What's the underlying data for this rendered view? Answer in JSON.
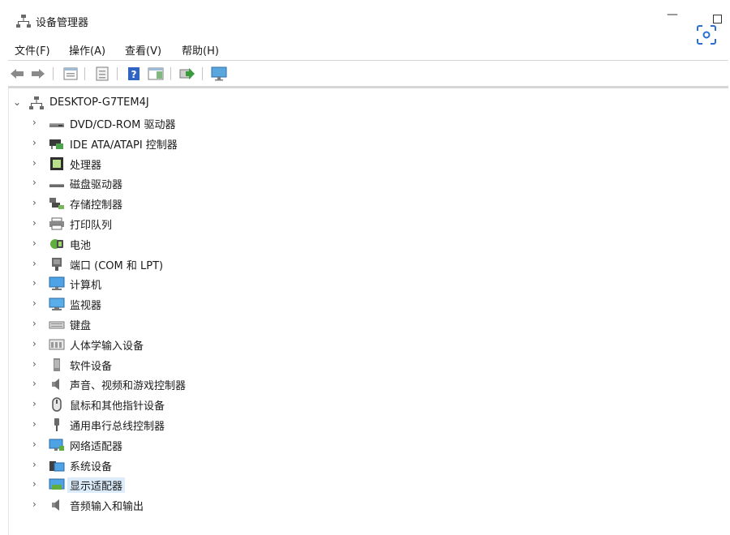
{
  "window": {
    "title": "设备管理器",
    "icons": {
      "app": "device-manager-icon",
      "minimize": "minimize-icon",
      "maximize": "maximize-icon",
      "overlay": "screenshot-lens-icon"
    }
  },
  "menu": [
    "文件(F)",
    "操作(A)",
    "查看(V)",
    "帮助(H)"
  ],
  "toolbar": [
    "back-arrow-icon",
    "forward-arrow-icon",
    "properties-icon",
    "show-hidden-icon",
    "help-icon",
    "action-pane-icon",
    "update-driver-icon",
    "scan-hardware-icon"
  ],
  "tree": {
    "root": {
      "label": "DESKTOP-G7TEM4J",
      "icon": "computer-network-icon",
      "expanded": true
    },
    "items": [
      {
        "label": "DVD/CD-ROM 驱动器",
        "icon": "dvd-drive-icon"
      },
      {
        "label": "IDE ATA/ATAPI 控制器",
        "icon": "ide-controller-icon"
      },
      {
        "label": "处理器",
        "icon": "processor-icon"
      },
      {
        "label": "磁盘驱动器",
        "icon": "disk-drive-icon"
      },
      {
        "label": "存储控制器",
        "icon": "storage-controller-icon"
      },
      {
        "label": "打印队列",
        "icon": "printer-icon"
      },
      {
        "label": "电池",
        "icon": "battery-icon"
      },
      {
        "label": "端口 (COM 和 LPT)",
        "icon": "port-icon"
      },
      {
        "label": "计算机",
        "icon": "computer-icon"
      },
      {
        "label": "监视器",
        "icon": "monitor-icon"
      },
      {
        "label": "键盘",
        "icon": "keyboard-icon"
      },
      {
        "label": "人体学输入设备",
        "icon": "hid-icon"
      },
      {
        "label": "软件设备",
        "icon": "software-device-icon"
      },
      {
        "label": "声音、视频和游戏控制器",
        "icon": "speaker-icon"
      },
      {
        "label": "鼠标和其他指针设备",
        "icon": "mouse-icon"
      },
      {
        "label": "通用串行总线控制器",
        "icon": "usb-icon"
      },
      {
        "label": "网络适配器",
        "icon": "network-adapter-icon"
      },
      {
        "label": "系统设备",
        "icon": "system-device-icon"
      },
      {
        "label": "显示适配器",
        "icon": "display-adapter-icon",
        "selected": true
      },
      {
        "label": "音频输入和输出",
        "icon": "audio-io-icon"
      }
    ]
  }
}
